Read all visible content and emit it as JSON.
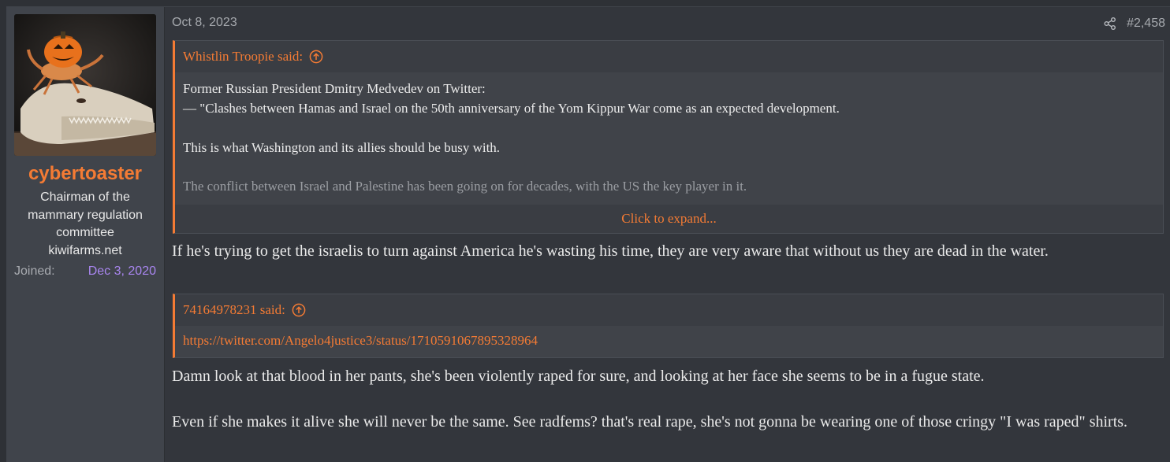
{
  "user": {
    "avatar_icon": "avatar-pumpkin-alligator",
    "username": "cybertoaster",
    "title_lines": [
      "Chairman of the",
      "mammary regulation",
      "committee",
      "kiwifarms.net"
    ],
    "joined_label": "Joined:",
    "joined_date": "Dec 3, 2020"
  },
  "post": {
    "date": "Oct 8, 2023",
    "share_icon": "share-icon",
    "number": "#2,458",
    "quote1": {
      "author": "Whistlin Troopie said:",
      "lines": [
        "Former Russian President Dmitry Medvedev on Twitter:",
        "— \"Clashes between Hamas and Israel on the 50th anniversary of the Yom Kippur War come as an expected development.",
        "This is what Washington and its allies should be busy with.",
        "The conflict between Israel and Palestine has been going on for decades, with the US the key player in it."
      ],
      "expand": "Click to expand..."
    },
    "reply1": "If he's trying to get the israelis to turn against America he's wasting his time, they are very aware that without us they are dead in the water.",
    "quote2": {
      "author": "74164978231 said:",
      "link": "https://twitter.com/Angelo4justice3/status/1710591067895328964"
    },
    "reply2": "Damn look at that blood in her pants, she's been violently raped for sure, and looking at her face she seems to be in a fugue state.",
    "reply3": "Even if she makes it alive she will never be the same. See radfems? that's real rape, she's not gonna be wearing one of those cringy \"I was raped\" shirts."
  },
  "colors": {
    "accent": "#f47b34",
    "joined_date": "#a986f0",
    "background": "#33363c",
    "sidebar": "#40444b"
  }
}
